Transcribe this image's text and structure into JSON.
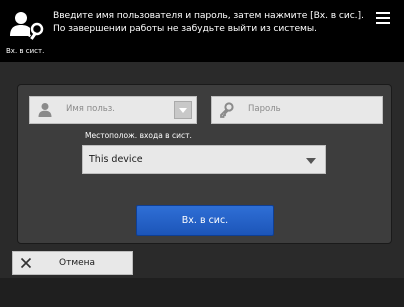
{
  "header": {
    "message_line1": "Введите имя пользователя и пароль, затем нажмите [Вх. в сис.].",
    "message_line2": "По завершении работы не забудьте выйти из системы.",
    "status": "Вх. в сист.",
    "icon": "user-key-icon",
    "menu_icon": "menu-icon"
  },
  "login_form": {
    "username_placeholder": "Имя польз.",
    "password_placeholder": "Пароль",
    "location_label": "Местополож. входа в сист.",
    "location_value": "This device",
    "login_button": "Вх. в сис."
  },
  "footer": {
    "cancel_label": "Отмена"
  },
  "colors": {
    "header_bg": "#000000",
    "panel_bg": "#3d3d3d",
    "primary_button": "#2163c8",
    "field_bg": "#e8e8e8"
  }
}
